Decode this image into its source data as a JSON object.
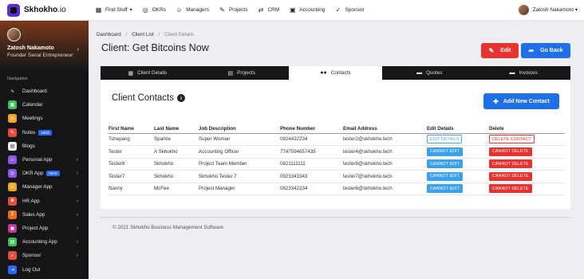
{
  "brand": {
    "name_bold": "Skhokho",
    "name_suffix": ".io"
  },
  "topnav": [
    {
      "icon": "grid",
      "label": "Find Stuff",
      "caret": "▾"
    },
    {
      "icon": "target",
      "label": "OKRs"
    },
    {
      "icon": "user-circle",
      "label": "Managers"
    },
    {
      "icon": "edit",
      "label": "Projects"
    },
    {
      "icon": "handshake",
      "label": "CRM"
    },
    {
      "icon": "money",
      "label": "Accounting"
    },
    {
      "icon": "check-circle",
      "label": "Sponsor"
    }
  ],
  "user": {
    "name": "Zatosh Nakamoto",
    "caret": "▾",
    "role": "Founder Serial Entrepreneur"
  },
  "sidebar": {
    "section_label": "Navigation",
    "items": [
      {
        "label": "Dashboard",
        "icon": "pulse",
        "color": "#151517"
      },
      {
        "label": "Calendar",
        "icon": "calendar",
        "color": "#3cc15a"
      },
      {
        "label": "Meetings",
        "icon": "meetings",
        "color": "#f2a51a"
      },
      {
        "label": "Notes",
        "icon": "notes",
        "color": "#e84c3d",
        "badge": "NEW"
      },
      {
        "label": "Blogs",
        "icon": "blog",
        "color": "#f2f2f2"
      },
      {
        "label": "Personal App",
        "icon": "person",
        "color": "#8b57e8",
        "arrow": "›"
      },
      {
        "label": "OKR App",
        "icon": "okr",
        "color": "#8b57e8",
        "badge": "NEW",
        "arrow": "›"
      },
      {
        "label": "Manager App",
        "icon": "manager",
        "color": "#f2a51a",
        "arrow": "›"
      },
      {
        "label": "HR App",
        "icon": "hr",
        "color": "#e84c3d",
        "arrow": "›"
      },
      {
        "label": "Sales App",
        "icon": "sales",
        "color": "#f26a1b",
        "arrow": "›"
      },
      {
        "label": "Project App",
        "icon": "project",
        "color": "#c6359b",
        "arrow": "›"
      },
      {
        "label": "Accounting App",
        "icon": "accounting",
        "color": "#3cc15a",
        "arrow": "›"
      },
      {
        "label": "Sponsor",
        "icon": "rocket",
        "color": "#e84c3d",
        "arrow": "›"
      },
      {
        "label": "Log Out",
        "icon": "logout",
        "color": "#2a66ff"
      }
    ]
  },
  "breadcrumb": {
    "items": [
      "Dashboard",
      "Client List"
    ],
    "current": "Client Details",
    "sep": "/"
  },
  "page_title": "Client: Get Bitcoins Now",
  "buttons": {
    "edit": "Edit",
    "back": "Go Back",
    "add_contact": "Add New Contact"
  },
  "tabs": [
    {
      "label": "Client Details",
      "icon": "▦"
    },
    {
      "label": "Projects",
      "icon": "▤"
    },
    {
      "label": "Contacts",
      "icon": "👥",
      "active": true
    },
    {
      "label": "Quotes",
      "icon": "▬"
    },
    {
      "label": "Invoices",
      "icon": "▬"
    }
  ],
  "contacts": {
    "title": "Client Contacts",
    "columns": [
      "First Name",
      "Last Name",
      "Job Description",
      "Phone Number",
      "Email Address",
      "Edit Details",
      "Delete"
    ],
    "rows": [
      {
        "first": "Tshepang",
        "last": "Sparkle",
        "job": "Super Woman",
        "phone": "0824432234",
        "email": "tester2@skhokho.tech",
        "edit": "EDIT DETAILS",
        "edit_enabled": true,
        "delete": "DELETE CONTACT",
        "delete_enabled": true
      },
      {
        "first": "Tester",
        "last": "A Skhokho",
        "job": "Accounting Officer",
        "phone": "7747594657435",
        "email": "tester4@skhokho.tech",
        "edit": "CANNOT EDIT",
        "edit_enabled": false,
        "delete": "CANNOT DELETE",
        "delete_enabled": false
      },
      {
        "first": "Tester8",
        "last": "Skhokho",
        "job": "Project Team Member",
        "phone": "0821111111",
        "email": "tester8@skhokho.tech",
        "edit": "CANNOT EDIT",
        "edit_enabled": false,
        "delete": "CANNOT DELETE",
        "delete_enabled": false
      },
      {
        "first": "Tester7",
        "last": "Skhokho",
        "job": "Skhokho Tester 7",
        "phone": "0923343343",
        "email": "tester7@skhokho.tech",
        "edit": "CANNOT EDIT",
        "edit_enabled": false,
        "delete": "CANNOT DELETE",
        "delete_enabled": false
      },
      {
        "first": "Nanny",
        "last": "McFee",
        "job": "Project Manager",
        "phone": "0823342234",
        "email": "tester6@skhokho.tech",
        "edit": "CANNOT EDIT",
        "edit_enabled": false,
        "delete": "CANNOT DELETE",
        "delete_enabled": false
      }
    ]
  },
  "footer": "© 2021 Skhokho Business Management Software"
}
